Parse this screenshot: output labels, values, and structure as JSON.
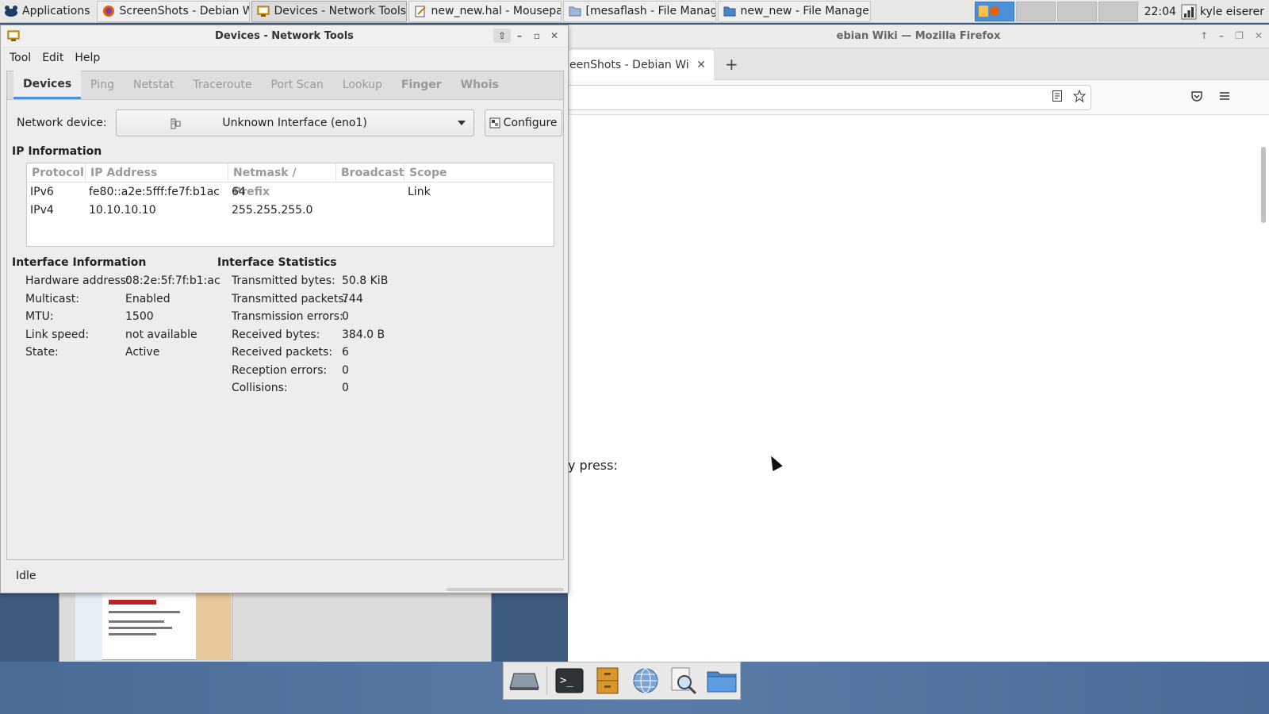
{
  "top_panel": {
    "applications_label": "Applications",
    "tasks": [
      {
        "label": "ScreenShots - Debian W...",
        "icon": "firefox-icon",
        "active": false
      },
      {
        "label": "Devices - Network Tools",
        "icon": "network-tools-icon",
        "active": true
      },
      {
        "label": "new_new.hal - Mousepad",
        "icon": "mousepad-icon",
        "active": false
      },
      {
        "label": "[mesaflash - File Manag...",
        "icon": "folder-icon",
        "active": false
      },
      {
        "label": "new_new - File Manager",
        "icon": "folder-icon",
        "active": false
      }
    ],
    "clock": "22:04",
    "user": "kyle eiserer"
  },
  "firefox": {
    "title": "ebian Wiki — Mozilla Firefox",
    "tab_label": "eenShots - Debian Wi",
    "page_text": "y press:"
  },
  "network_tools": {
    "title": "Devices - Network Tools",
    "menu": [
      "Tool",
      "Edit",
      "Help"
    ],
    "tabs": [
      "Devices",
      "Ping",
      "Netstat",
      "Traceroute",
      "Port Scan",
      "Lookup",
      "Finger",
      "Whois"
    ],
    "device_label": "Network device:",
    "device_value": "Unknown Interface (eno1)",
    "configure_label": "Configure",
    "ip_section_title": "IP Information",
    "ip_columns": [
      "Protocol",
      "IP Address",
      "Netmask / Prefix",
      "Broadcast",
      "Scope"
    ],
    "ip_rows": [
      {
        "protocol": "IPv6",
        "address": "fe80::a2e:5fff:fe7f:b1ac",
        "netmask": "64",
        "broadcast": "",
        "scope": "Link"
      },
      {
        "protocol": "IPv4",
        "address": "10.10.10.10",
        "netmask": "255.255.255.0",
        "broadcast": "",
        "scope": ""
      }
    ],
    "interface_info_title": "Interface Information",
    "interface_info": [
      {
        "key": "Hardware address:",
        "value": "08:2e:5f:7f:b1:ac"
      },
      {
        "key": "Multicast:",
        "value": "Enabled"
      },
      {
        "key": "MTU:",
        "value": "1500"
      },
      {
        "key": "Link speed:",
        "value": "not available"
      },
      {
        "key": "State:",
        "value": "Active"
      }
    ],
    "interface_stats_title": "Interface Statistics",
    "interface_stats": [
      {
        "key": "Transmitted bytes:",
        "value": "50.8 KiB"
      },
      {
        "key": "Transmitted packets:",
        "value": "744"
      },
      {
        "key": "Transmission errors:",
        "value": "0"
      },
      {
        "key": "Received bytes:",
        "value": "384.0 B"
      },
      {
        "key": "Received packets:",
        "value": "6"
      },
      {
        "key": "Reception errors:",
        "value": "0"
      },
      {
        "key": "Collisions:",
        "value": "0"
      }
    ],
    "status": "Idle"
  },
  "dock": {
    "icons": [
      "show-desktop-icon",
      "terminal-icon",
      "file-cabinet-icon",
      "web-browser-icon",
      "search-icon",
      "folder-icon"
    ]
  },
  "colors": {
    "accent": "#4a90d9",
    "panel_bg": "#e8e8e7",
    "desktop": "#4a6b94"
  }
}
